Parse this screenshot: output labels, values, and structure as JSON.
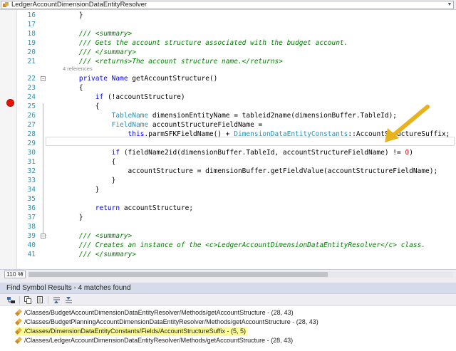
{
  "top_dropdown": {
    "label": "LedgerAccountDimensionDataEntityResolver",
    "icon": "class-icon"
  },
  "editor": {
    "references_label": "4 references",
    "lines": [
      {
        "num": "16",
        "code": [
          {
            "t": "    }",
            "c": ""
          }
        ]
      },
      {
        "num": "17",
        "code": []
      },
      {
        "num": "18",
        "code": [
          {
            "t": "    /// <summary>",
            "c": "cm"
          }
        ]
      },
      {
        "num": "19",
        "code": [
          {
            "t": "    /// Gets the account structure associated with the budget account.",
            "c": "cm"
          }
        ]
      },
      {
        "num": "20",
        "code": [
          {
            "t": "    /// </summary>",
            "c": "cm"
          }
        ]
      },
      {
        "num": "21",
        "code": [
          {
            "t": "    /// <returns>The account structure name.</returns>",
            "c": "cm"
          }
        ]
      },
      {
        "num": "22",
        "code": [
          {
            "t": "    ",
            "c": ""
          },
          {
            "t": "private",
            "c": "kw"
          },
          {
            "t": " ",
            "c": ""
          },
          {
            "t": "Name",
            "c": "kw"
          },
          {
            "t": " getAccountStructure()",
            "c": ""
          }
        ]
      },
      {
        "num": "23",
        "code": [
          {
            "t": "    {",
            "c": ""
          }
        ]
      },
      {
        "num": "24",
        "code": [
          {
            "t": "        ",
            "c": ""
          },
          {
            "t": "if",
            "c": "kw"
          },
          {
            "t": " (!accountStructure)",
            "c": ""
          }
        ]
      },
      {
        "num": "25",
        "code": [
          {
            "t": "        {",
            "c": ""
          }
        ]
      },
      {
        "num": "26",
        "code": [
          {
            "t": "            ",
            "c": ""
          },
          {
            "t": "TableName",
            "c": "ty"
          },
          {
            "t": " dimensionEntityName = tableid2name(dimensionBuffer.TableId);",
            "c": ""
          }
        ]
      },
      {
        "num": "27",
        "code": [
          {
            "t": "            ",
            "c": ""
          },
          {
            "t": "FieldName",
            "c": "ty"
          },
          {
            "t": " accountStructureFieldName =",
            "c": ""
          }
        ]
      },
      {
        "num": "28",
        "code": [
          {
            "t": "                ",
            "c": ""
          },
          {
            "t": "this",
            "c": "kw"
          },
          {
            "t": ".parmSFKFieldName() + ",
            "c": ""
          },
          {
            "t": "DimensionDataEntityConstants",
            "c": "ty"
          },
          {
            "t": "::AccountStructureSuffix;",
            "c": ""
          }
        ]
      },
      {
        "num": "29",
        "code": []
      },
      {
        "num": "30",
        "code": [
          {
            "t": "            ",
            "c": ""
          },
          {
            "t": "if",
            "c": "kw"
          },
          {
            "t": " (fieldName2id(dimensionBuffer.TableId, accountStructureFieldName) != ",
            "c": ""
          },
          {
            "t": "0",
            "c": "num"
          },
          {
            "t": ")",
            "c": ""
          }
        ]
      },
      {
        "num": "31",
        "code": [
          {
            "t": "            {",
            "c": ""
          }
        ]
      },
      {
        "num": "32",
        "code": [
          {
            "t": "                accountStructure = dimensionBuffer.getFieldValue(accountStructureFieldName);",
            "c": ""
          }
        ]
      },
      {
        "num": "33",
        "code": [
          {
            "t": "            }",
            "c": ""
          }
        ]
      },
      {
        "num": "34",
        "code": [
          {
            "t": "        }",
            "c": ""
          }
        ]
      },
      {
        "num": "35",
        "code": []
      },
      {
        "num": "36",
        "code": [
          {
            "t": "        ",
            "c": ""
          },
          {
            "t": "return",
            "c": "kw"
          },
          {
            "t": " accountStructure;",
            "c": ""
          }
        ]
      },
      {
        "num": "37",
        "code": [
          {
            "t": "    }",
            "c": ""
          }
        ]
      },
      {
        "num": "38",
        "code": []
      },
      {
        "num": "39",
        "code": [
          {
            "t": "    /// <summary>",
            "c": "cm"
          }
        ]
      },
      {
        "num": "40",
        "code": [
          {
            "t": "    /// Creates an instance of the <c>LedgerAccountDimensionDataEntityResolver</c> class.",
            "c": "cm"
          }
        ]
      },
      {
        "num": "41",
        "code": [
          {
            "t": "    /// </summary>",
            "c": "cm"
          }
        ]
      }
    ],
    "breakpoint_line": "24",
    "current_line": "28",
    "annotation": "yellow-arrow-pointing-at-AccountStructureSuffix"
  },
  "zoom": {
    "value": "110 %"
  },
  "results_panel": {
    "title": "Find Symbol Results - 4 matches found",
    "toolbar_icons": [
      "go-to-definition-icon",
      "copy-icon",
      "clear-icon",
      "previous-icon",
      "next-icon"
    ],
    "results": [
      {
        "text": "/Classes/BudgetAccountDimensionDataEntityResolver/Methods/getAccountStructure - (28, 43)",
        "highlighted": false
      },
      {
        "text": "/Classes/BudgetPlanningAccountDimensionDataEntityResolver/Methods/getAccountStructure - (28, 43)",
        "highlighted": false
      },
      {
        "text": "/Classes/DimensionDataEntityConstants/Fields/AccountStructureSuffix - (5, 5)",
        "highlighted": true
      },
      {
        "text": "/Classes/LedgerAccountDimensionDataEntityResolver/Methods/getAccountStructure - (28, 43)",
        "highlighted": false
      }
    ],
    "highlight_color": "#fdfd9a"
  }
}
